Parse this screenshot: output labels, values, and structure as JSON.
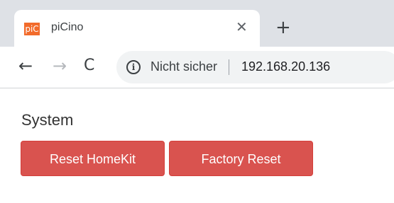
{
  "browser": {
    "tab": {
      "favicon_text": "piC",
      "title": "piCino",
      "close_glyph": "✕"
    },
    "new_tab_glyph": "+",
    "nav": {
      "back_glyph": "←",
      "forward_glyph": "→",
      "reload_glyph": "C"
    },
    "address": {
      "info_glyph": "i",
      "security_label": "Nicht sicher",
      "url": "192.168.20.136"
    }
  },
  "page": {
    "section_title": "System",
    "buttons": {
      "reset_homekit": "Reset HomeKit",
      "factory_reset": "Factory Reset"
    }
  },
  "colors": {
    "danger": "#d9534f",
    "favicon": "#f26b2b"
  }
}
